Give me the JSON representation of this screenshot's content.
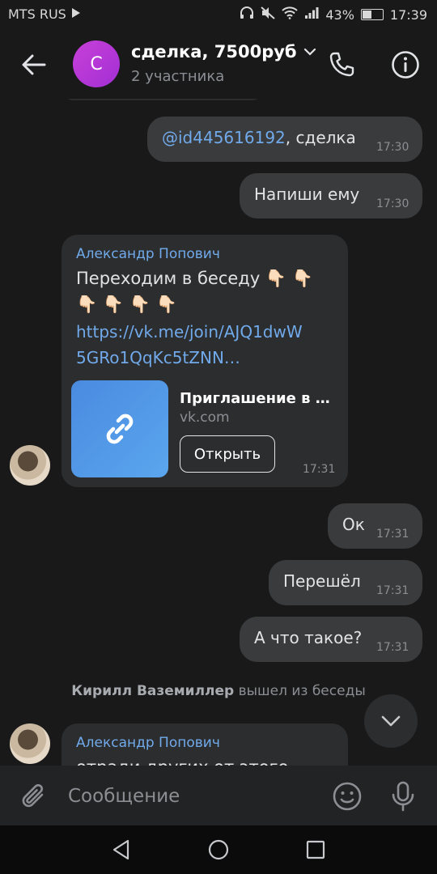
{
  "status_bar": {
    "carrier": "MTS RUS",
    "battery": "43%",
    "battery_level": 0.43,
    "time": "17:39"
  },
  "header": {
    "avatar_letter": "С",
    "title": "сделка, 7500руб",
    "subtitle": "2 участника"
  },
  "messages": [
    {
      "mention": "@id445616192",
      "text": ", сделка",
      "time": "17:30"
    },
    {
      "text": "Напиши ему",
      "time": "17:30"
    },
    {
      "sender": "Александр Попович",
      "line1": "Переходим в беседу 👇🏻 👇🏻",
      "line2": "👇🏻 👇🏻 👇🏻 👇🏻",
      "link_line1": "https://vk.me/join/AJQ1dwW",
      "link_line2": "5GRo1QqKc5tZNN…",
      "card_title": "Приглашение в …",
      "card_domain": "vk.com",
      "card_button": "Открыть",
      "time": "17:31"
    },
    {
      "text": "Ок",
      "time": "17:31"
    },
    {
      "text": "Перешёл",
      "time": "17:31"
    },
    {
      "text": "А что такое?",
      "time": "17:31"
    }
  ],
  "system_message": {
    "name": "Кирилл Ваземиллер",
    "action": "вышел из беседы"
  },
  "last_message": {
    "sender": "Александр Попович",
    "partial_text": "отради других от этого"
  },
  "composer": {
    "placeholder": "Сообщение"
  },
  "icons": {
    "back": "arrow-left-icon",
    "call": "phone-icon",
    "info": "info-icon",
    "link": "link-icon",
    "scroll": "chevron-down-icon",
    "attach": "paperclip-icon",
    "emoji": "smile-icon",
    "mic": "microphone-icon"
  },
  "colors": {
    "accent": "#71aaeb",
    "bubble_out": "#3a3b3c",
    "bubble_in": "#2c2d2e",
    "avatar": "#b83ad6"
  }
}
